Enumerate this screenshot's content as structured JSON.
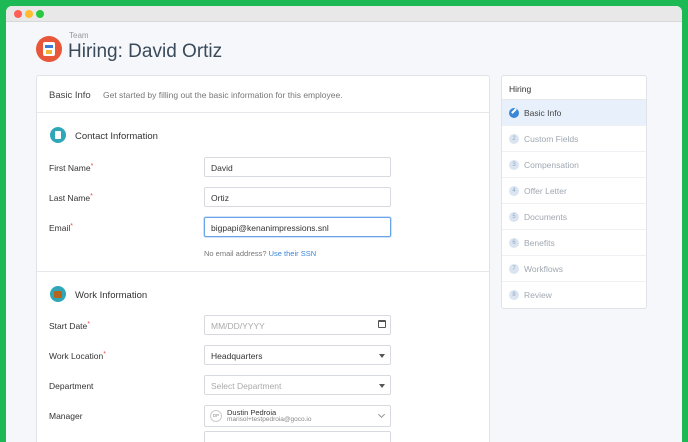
{
  "header": {
    "breadcrumb": "Team",
    "title": "Hiring: David Ortiz"
  },
  "basic_info": {
    "title": "Basic Info",
    "description": "Get started by filling out the basic information for this employee."
  },
  "contact": {
    "section_title": "Contact Information",
    "first_name_label": "First Name",
    "first_name_value": "David",
    "last_name_label": "Last Name",
    "last_name_value": "Ortiz",
    "email_label": "Email",
    "email_value": "bigpapi@kenanimpressions.snl",
    "no_email_hint": "No email address?",
    "use_ssn_link": "Use their SSN",
    "required_mark": "*"
  },
  "work": {
    "section_title": "Work Information",
    "start_date_label": "Start Date",
    "start_date_placeholder": "MM/DD/YYYY",
    "location_label": "Work Location",
    "location_value": "Headquarters",
    "department_label": "Department",
    "department_placeholder": "Select Department",
    "manager_label": "Manager",
    "manager_initials": "DP",
    "manager_name": "Dustin Pedroia",
    "manager_email": "marisol+testpedroia@goco.io"
  },
  "sidebar": {
    "title": "Hiring",
    "items": [
      {
        "num": "1",
        "label": "Basic Info",
        "active": true
      },
      {
        "num": "2",
        "label": "Custom Fields"
      },
      {
        "num": "3",
        "label": "Compensation"
      },
      {
        "num": "4",
        "label": "Offer Letter"
      },
      {
        "num": "5",
        "label": "Documents"
      },
      {
        "num": "6",
        "label": "Benefits"
      },
      {
        "num": "7",
        "label": "Workflows"
      },
      {
        "num": "8",
        "label": "Review"
      }
    ]
  },
  "colors": {
    "background": "#1db954",
    "accent": "#3a86d8",
    "required": "#e24c4c"
  }
}
